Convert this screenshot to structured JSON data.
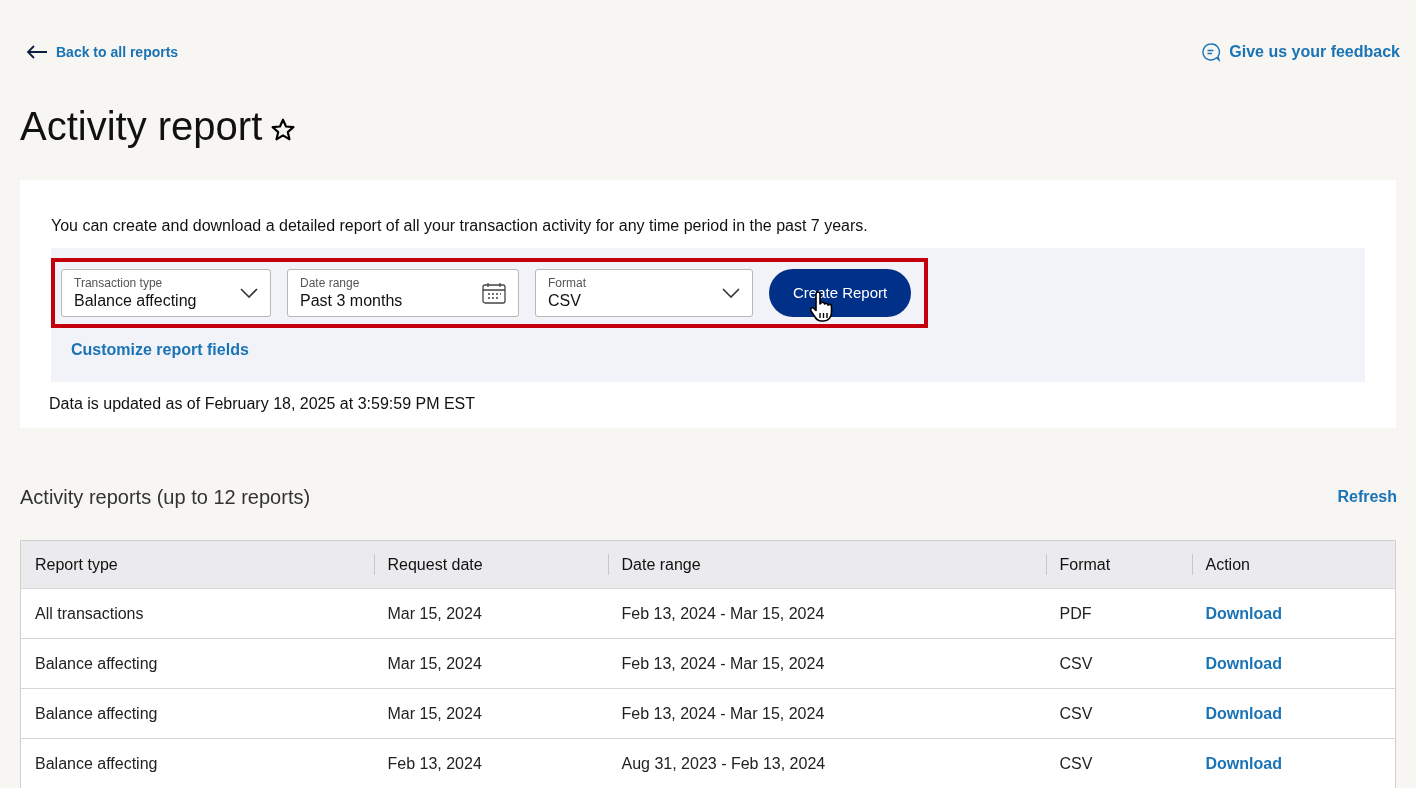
{
  "back_link": "Back to all reports",
  "feedback_link": "Give us your feedback",
  "title": "Activity report",
  "favorite": false,
  "intro": "You can create and download a detailed report of all your transaction activity for any time period in the past 7 years.",
  "filters": [
    {
      "kind": "select",
      "label": "Transaction type",
      "value": "Balance affecting"
    },
    {
      "kind": "date",
      "label": "Date range",
      "value": "Past 3 months"
    },
    {
      "kind": "select",
      "label": "Format",
      "value": "CSV"
    }
  ],
  "create_button": "Create Report",
  "customize_link": "Customize report fields",
  "updated_note": "Data is updated as of February 18, 2025 at 3:59:59 PM EST",
  "reports_heading": "Activity reports (up to 12 reports)",
  "refresh_link": "Refresh",
  "table": {
    "columns": [
      "Report type",
      "Request date",
      "Date range",
      "Format",
      "Action"
    ],
    "rows": [
      [
        "All transactions",
        "Mar 15, 2024",
        "Feb 13, 2024 - Mar 15, 2024",
        "PDF",
        "Download"
      ],
      [
        "Balance affecting",
        "Mar 15, 2024",
        "Feb 13, 2024 - Mar 15, 2024",
        "CSV",
        "Download"
      ],
      [
        "Balance affecting",
        "Mar 15, 2024",
        "Feb 13, 2024 - Mar 15, 2024",
        "CSV",
        "Download"
      ],
      [
        "Balance affecting",
        "Feb 13, 2024",
        "Aug 31, 2023 - Feb 13, 2024",
        "CSV",
        "Download"
      ]
    ]
  }
}
